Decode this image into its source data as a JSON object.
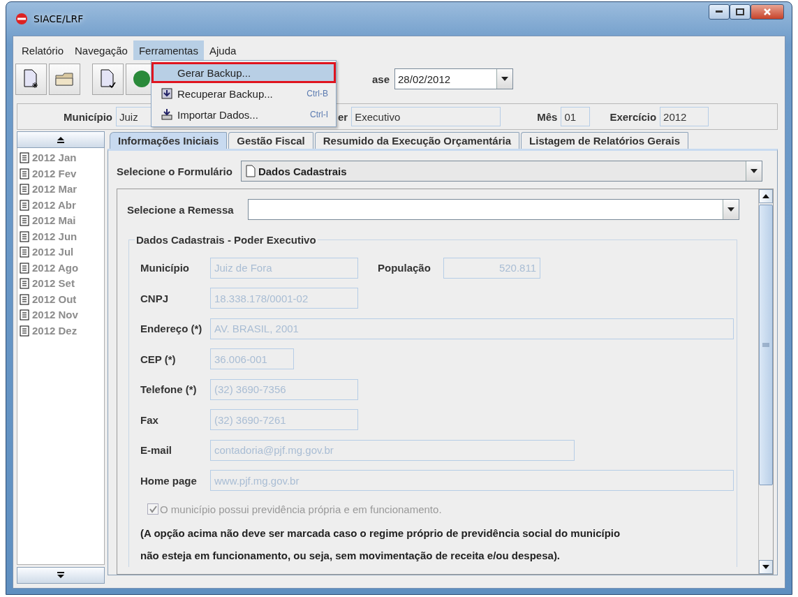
{
  "window": {
    "title": "SIACE/LRF"
  },
  "menu_bar": [
    {
      "label": "Relatório",
      "selected": false
    },
    {
      "label": "Navegação",
      "selected": false
    },
    {
      "label": "Ferramentas",
      "selected": true
    },
    {
      "label": "Ajuda",
      "selected": false
    }
  ],
  "open_menu": {
    "items": [
      {
        "label": "Gerar Backup...",
        "selected": true,
        "kind": "plain"
      },
      {
        "label": "Recuperar Backup...",
        "shortcut": "Ctrl-B",
        "selected": false,
        "kind": "restore"
      },
      {
        "label": "Importar Dados...",
        "shortcut": "Ctrl-I",
        "selected": false,
        "kind": "import"
      }
    ]
  },
  "toolbar": {
    "date_label": "ase",
    "date_value": "28/02/2012"
  },
  "header_fields": [
    {
      "label": "Município",
      "value": "Juiz"
    },
    {
      "label": "er",
      "value": "Executivo"
    },
    {
      "label": "Mês",
      "value": "01"
    },
    {
      "label": "Exercício",
      "value": "2012"
    }
  ],
  "tabs": [
    {
      "label": "Informações Iniciais",
      "selected": true
    },
    {
      "label": "Gestão Fiscal",
      "selected": false
    },
    {
      "label": "Resumido da Execução Orçamentária",
      "selected": false
    },
    {
      "label": "Listagem de Relatórios Gerais",
      "selected": false
    }
  ],
  "sidebar": {
    "items": [
      "2012 Jan",
      "2012 Fev",
      "2012 Mar",
      "2012 Abr",
      "2012 Mai",
      "2012 Jun",
      "2012 Jul",
      "2012 Ago",
      "2012 Set",
      "2012 Out",
      "2012 Nov",
      "2012 Dez"
    ]
  },
  "form": {
    "formulario_label": "Selecione o Formulário",
    "formulario_value": "Dados Cadastrais",
    "remessa_label": "Selecione a Remessa",
    "group_title": "Dados Cadastrais - Poder Executivo",
    "rows": [
      [
        {
          "label": "Município",
          "value": "Juiz de Fora"
        },
        {
          "label": "População",
          "value": "520.811"
        }
      ],
      [
        {
          "label": "CNPJ",
          "value": "18.338.178/0001-02"
        }
      ],
      [
        {
          "label": "Endereço (*)",
          "value": "AV. BRASIL, 2001"
        }
      ],
      [
        {
          "label": "CEP (*)",
          "value": "36.006-001"
        }
      ],
      [
        {
          "label": "Telefone (*)",
          "value": "(32) 3690-7356"
        }
      ],
      [
        {
          "label": "Fax",
          "value": "(32) 3690-7261"
        }
      ],
      [
        {
          "label": "E-mail",
          "value": "contadoria@pjf.mg.gov.br"
        }
      ],
      [
        {
          "label": "Home page",
          "value": "www.pjf.mg.gov.br"
        }
      ]
    ],
    "checkbox": {
      "label": "O município possui previdência própria e em funcionamento.",
      "checked": true,
      "disabled": true
    },
    "note_lines": [
      "(A opção acima não deve ser marcada caso o regime próprio de previdência social do município",
      "não esteja em funcionamento, ou seja, sem movimentação de receita e/ou despesa)."
    ]
  }
}
